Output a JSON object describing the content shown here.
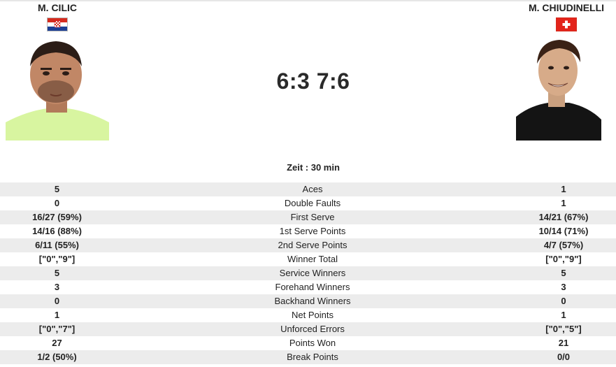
{
  "players": {
    "left": {
      "name": "M. CILIC",
      "flag": "croatia-flag"
    },
    "right": {
      "name": "M. CHIUDINELLI",
      "flag": "switzerland-flag"
    }
  },
  "score": "6:3 7:6",
  "time": "Zeit : 30 min",
  "stats": [
    {
      "label": "Aces",
      "left": "5",
      "right": "1"
    },
    {
      "label": "Double Faults",
      "left": "0",
      "right": "1"
    },
    {
      "label": "First Serve",
      "left": "16/27 (59%)",
      "right": "14/21 (67%)"
    },
    {
      "label": "1st Serve Points",
      "left": "14/16 (88%)",
      "right": "10/14 (71%)"
    },
    {
      "label": "2nd Serve Points",
      "left": "6/11 (55%)",
      "right": "4/7 (57%)"
    },
    {
      "label": "Winner Total",
      "left": "[\"0\",\"9\"]",
      "right": "[\"0\",\"9\"]"
    },
    {
      "label": "Service Winners",
      "left": "5",
      "right": "5"
    },
    {
      "label": "Forehand Winners",
      "left": "3",
      "right": "3"
    },
    {
      "label": "Backhand Winners",
      "left": "0",
      "right": "0"
    },
    {
      "label": "Net Points",
      "left": "1",
      "right": "1"
    },
    {
      "label": "Unforced Errors",
      "left": "[\"0\",\"7\"]",
      "right": "[\"0\",\"5\"]"
    },
    {
      "label": "Points Won",
      "left": "27",
      "right": "21"
    },
    {
      "label": "Break Points",
      "left": "1/2 (50%)",
      "right": "0/0"
    }
  ],
  "colors": {
    "row_shade": "#ececec",
    "photo_left_bg": "#d8f5a0",
    "photo_right_bg": "#ffffff"
  }
}
